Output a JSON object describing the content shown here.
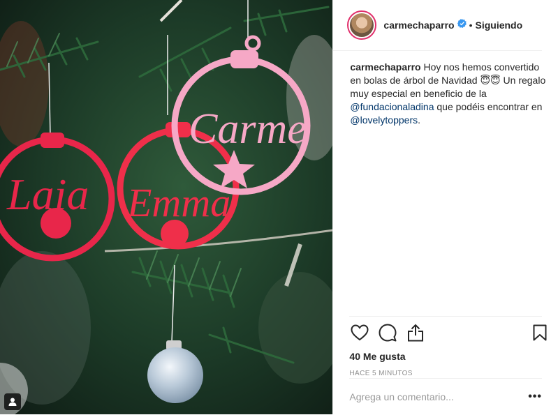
{
  "post": {
    "media": {
      "ornament_names": [
        "Laia",
        "Emma",
        "Carme"
      ],
      "colors": {
        "pink_ornament": "#f6a8c6",
        "red_ornament": "#ef2f4a",
        "crimson_ornament": "#e8264a",
        "tree_green": "#1e4a2e"
      }
    },
    "header": {
      "username": "carmechaparro",
      "verified_icon": "verified-badge-icon",
      "separator": "•",
      "follow_label": "Siguiendo"
    },
    "caption": {
      "username": "carmechaparro",
      "text_1": " Hoy nos hemos convertido en bolas de árbol de Navidad ",
      "emoji": "😇😇",
      "text_2": " Un regalo muy especial en beneficio de la ",
      "mention_1": "@fundacionaladina",
      "text_3": " que podéis encontrar en ",
      "mention_2": "@lovelytoppers",
      "text_4": "."
    },
    "actions": {
      "icons": [
        "heart-icon",
        "comment-icon",
        "share-icon",
        "bookmark-icon"
      ],
      "likes": "40 Me gusta",
      "timestamp": "HACE 5 MINUTOS"
    },
    "comment_box": {
      "placeholder": "Agrega un comentario...",
      "more_label": "•••"
    },
    "colors": {
      "accent_link": "#003569",
      "muted": "#8e8e8e",
      "border": "#efefef"
    }
  }
}
